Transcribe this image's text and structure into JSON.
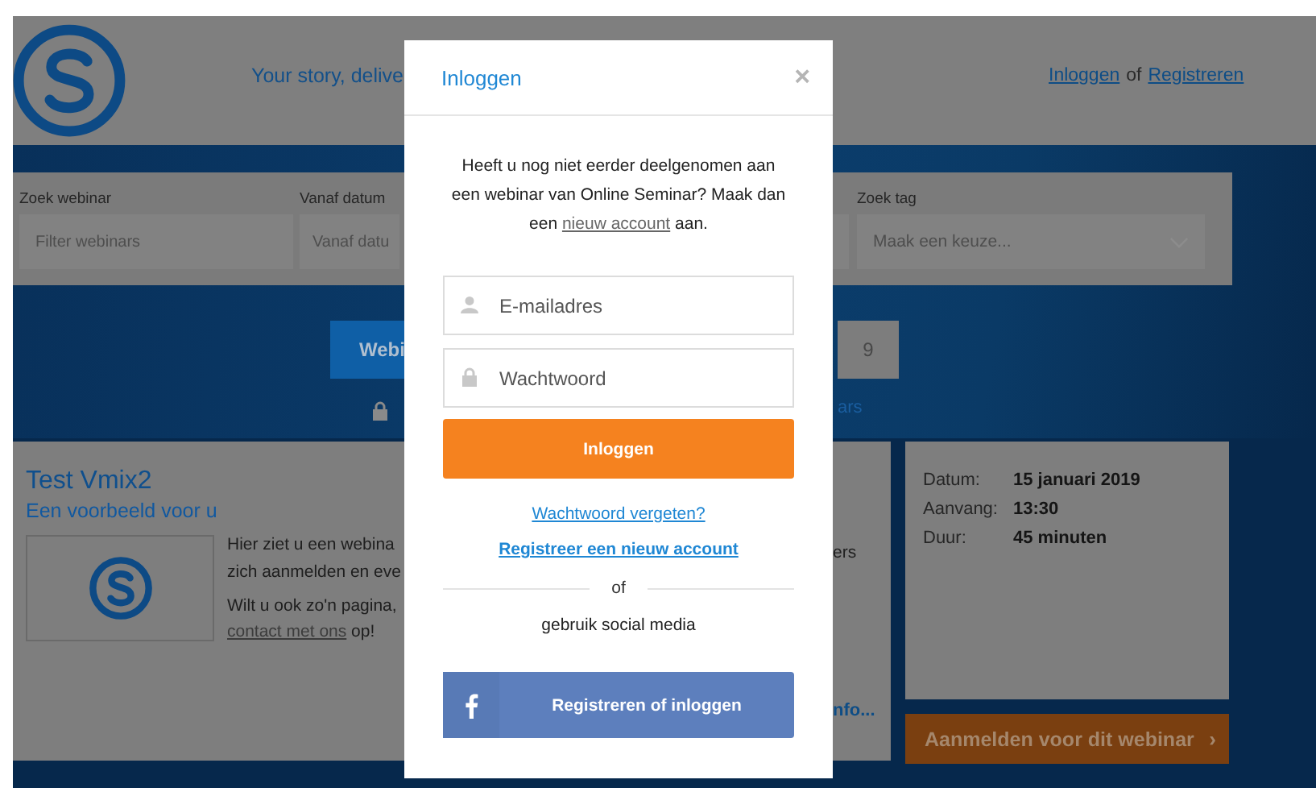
{
  "header": {
    "tagline": "Your story, delive",
    "links": [
      {
        "label": "Inloggen"
      },
      {
        "label": "Registreren"
      }
    ],
    "separator": "of"
  },
  "filters": [
    {
      "label": "Zoek webinar",
      "placeholder": "Filter webinars"
    },
    {
      "label": "Vanaf datum",
      "placeholder": "Vanaf datu"
    }
  ],
  "tag_filter": {
    "label": "Zoek tag",
    "placeholder": "Maak een keuze..."
  },
  "hero": {
    "button": "Webi",
    "count": "9",
    "link": "ars"
  },
  "webinar": {
    "title": "Test Vmix2",
    "subtitle": "Een voorbeeld voor u",
    "description": [
      "Hier ziet u een webina",
      "zich aanmelden en eve"
    ],
    "contact_prefix": "Wilt u ook zo'n pagina,",
    "contact_link": "contact met ons",
    "contact_suffix": "op!",
    "fragment": "ers",
    "more": "nfo...",
    "details": [
      {
        "label": "Datum:",
        "value": "15 januari 2019"
      },
      {
        "label": "Aanvang:",
        "value": "13:30"
      },
      {
        "label": "Duur:",
        "value": "45 minuten"
      }
    ],
    "register_button": "Aanmelden voor dit webinar",
    "register_chevron": "›"
  },
  "modal": {
    "title": "Inloggen",
    "close": "×",
    "intro_before": "Heeft u nog niet eerder deelgenomen aan een webinar van Online Seminar? Maak dan een",
    "intro_link": "nieuw account",
    "intro_after": "aan.",
    "email_placeholder": "E-mailadres",
    "password_placeholder": "Wachtwoord",
    "submit": "Inloggen",
    "forgot": "Wachtwoord vergeten?",
    "register": "Registreer een nieuw account",
    "divider": "of",
    "social_label": "gebruik social media",
    "facebook_button": "Registreren of inloggen"
  }
}
